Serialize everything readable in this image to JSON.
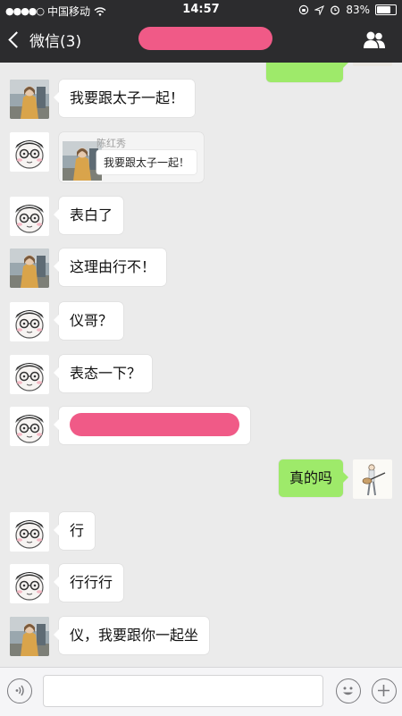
{
  "statusbar": {
    "carrier": "中国移动",
    "time": "14:57",
    "battery_text": "83%",
    "battery_level": 0.83
  },
  "navbar": {
    "back_label": "微信(3)"
  },
  "colors": {
    "outgoing_bubble": "#9eea6a",
    "incoming_bubble": "#ffffff",
    "redaction": "#f05a87",
    "header_bg": "#2c2c2e"
  },
  "messages": [
    {
      "direction": "in",
      "avatar": "photo-avatar",
      "text": "我要跟太子一起！"
    },
    {
      "direction": "in",
      "avatar": "cartoon-avatar",
      "type": "quote",
      "quote_name": "陈红秀",
      "quote_text": "我要跟太子一起！"
    },
    {
      "direction": "in",
      "avatar": "cartoon-avatar",
      "text": "表白了"
    },
    {
      "direction": "in",
      "avatar": "photo-avatar",
      "text": "这理由行不！"
    },
    {
      "direction": "in",
      "avatar": "cartoon-avatar",
      "text": "仪哥？"
    },
    {
      "direction": "in",
      "avatar": "cartoon-avatar",
      "text": "表态一下？"
    },
    {
      "direction": "in",
      "avatar": "cartoon-avatar",
      "type": "redacted"
    },
    {
      "direction": "out",
      "avatar": "guitar-avatar",
      "text": "真的吗"
    },
    {
      "direction": "in",
      "avatar": "cartoon-avatar",
      "text": "行"
    },
    {
      "direction": "in",
      "avatar": "cartoon-avatar",
      "text": "行行行"
    },
    {
      "direction": "in",
      "avatar": "photo-avatar",
      "text": "仪，我要跟你一起坐"
    }
  ],
  "inputbar": {
    "voice_icon": "voice-icon",
    "emoji_icon": "emoji-icon",
    "plus_icon": "plus-icon",
    "value": ""
  }
}
